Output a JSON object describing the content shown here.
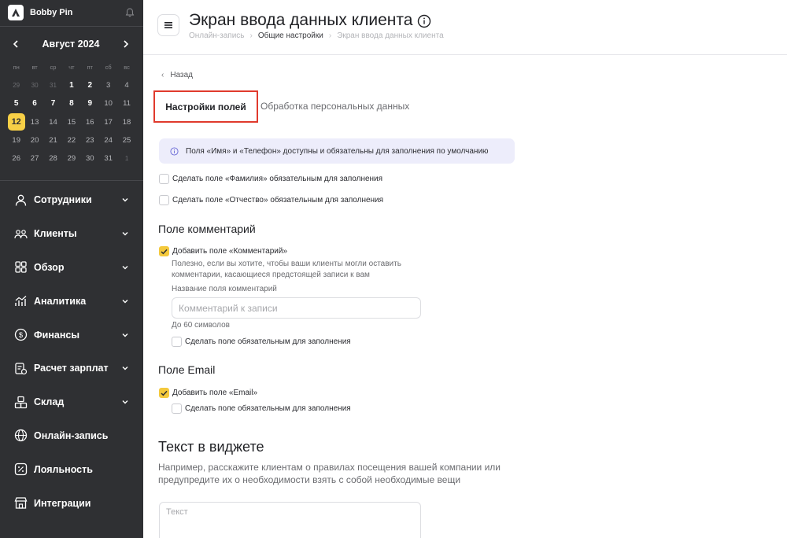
{
  "sidebar": {
    "brand": "Bobby Pin",
    "calendar": {
      "month": "Август 2024",
      "weekdays": [
        "пн",
        "вт",
        "ср",
        "чт",
        "пт",
        "сб",
        "вс"
      ],
      "weeks": [
        [
          {
            "d": "29",
            "t": "other"
          },
          {
            "d": "30",
            "t": "other"
          },
          {
            "d": "31",
            "t": "other"
          },
          {
            "d": "1",
            "t": "bold"
          },
          {
            "d": "2",
            "t": "bold"
          },
          {
            "d": "3",
            "t": "muted"
          },
          {
            "d": "4",
            "t": "muted"
          }
        ],
        [
          {
            "d": "5",
            "t": "bold"
          },
          {
            "d": "6",
            "t": "bold"
          },
          {
            "d": "7",
            "t": "bold"
          },
          {
            "d": "8",
            "t": "bold"
          },
          {
            "d": "9",
            "t": "bold"
          },
          {
            "d": "10",
            "t": "muted"
          },
          {
            "d": "11",
            "t": "muted"
          }
        ],
        [
          {
            "d": "12",
            "t": "today"
          },
          {
            "d": "13",
            "t": "muted"
          },
          {
            "d": "14",
            "t": "muted"
          },
          {
            "d": "15",
            "t": "muted"
          },
          {
            "d": "16",
            "t": "muted"
          },
          {
            "d": "17",
            "t": "muted"
          },
          {
            "d": "18",
            "t": "muted"
          }
        ],
        [
          {
            "d": "19",
            "t": "muted"
          },
          {
            "d": "20",
            "t": "muted"
          },
          {
            "d": "21",
            "t": "muted"
          },
          {
            "d": "22",
            "t": "muted"
          },
          {
            "d": "23",
            "t": "muted"
          },
          {
            "d": "24",
            "t": "muted"
          },
          {
            "d": "25",
            "t": "muted"
          }
        ],
        [
          {
            "d": "26",
            "t": "muted"
          },
          {
            "d": "27",
            "t": "muted"
          },
          {
            "d": "28",
            "t": "muted"
          },
          {
            "d": "29",
            "t": "muted"
          },
          {
            "d": "30",
            "t": "muted"
          },
          {
            "d": "31",
            "t": "muted"
          },
          {
            "d": "1",
            "t": "other"
          }
        ]
      ]
    },
    "nav": [
      {
        "label": "Сотрудники",
        "icon": "person-icon",
        "name": "employees",
        "chevron": true
      },
      {
        "label": "Клиенты",
        "icon": "users-icon",
        "name": "clients",
        "chevron": true
      },
      {
        "label": "Обзор",
        "icon": "grid-icon",
        "name": "overview",
        "chevron": true
      },
      {
        "label": "Аналитика",
        "icon": "analytics-icon",
        "name": "analytics",
        "chevron": true
      },
      {
        "label": "Финансы",
        "icon": "dollar-icon",
        "name": "finance",
        "chevron": true
      },
      {
        "label": "Расчет зарплат",
        "icon": "payroll-icon",
        "name": "payroll",
        "chevron": true
      },
      {
        "label": "Склад",
        "icon": "boxes-icon",
        "name": "warehouse",
        "chevron": true
      },
      {
        "label": "Онлайн-запись",
        "icon": "globe-icon",
        "name": "online-booking",
        "chevron": false
      },
      {
        "label": "Лояльность",
        "icon": "percent-icon",
        "name": "loyalty",
        "chevron": false
      },
      {
        "label": "Интеграции",
        "icon": "store-icon",
        "name": "integrations",
        "chevron": false
      }
    ]
  },
  "header": {
    "title": "Экран ввода данных клиента",
    "breadcrumb": [
      "Онлайн-запись",
      "Общие настройки",
      "Экран ввода данных клиента"
    ]
  },
  "main": {
    "back_label": "Назад",
    "tabs": [
      "Настройки полей",
      "Обработка персональных данных"
    ],
    "notice": "Поля «Имя» и «Телефон» доступны и обязательны для заполнения по умолчанию",
    "surname_required": "Сделать поле «Фамилия» обязательным для заполнения",
    "patronymic_required": "Сделать поле «Отчество» обязательным для заполнения",
    "comment_section": {
      "title": "Поле комментарий",
      "add_label": "Добавить поле «Комментарий»",
      "hint": "Полезно, если вы хотите, чтобы ваши клиенты могли оставить комментарии, касающиеся предстоящей записи к вам",
      "field_label": "Название поля комментарий",
      "placeholder": "Комментарий к записи",
      "limit": "До 60 символов",
      "required_label": "Сделать поле обязательным для заполнения"
    },
    "email_section": {
      "title": "Поле Email",
      "add_label": "Добавить поле «Email»",
      "required_label": "Сделать поле обязательным для заполнения"
    },
    "widget_section": {
      "title": "Текст в виджете",
      "description": "Например, расскажите клиентам о правилах посещения вашей компании или предупредите их о необходимости взять с собой необходимые вещи",
      "placeholder": "Текст"
    }
  },
  "colors": {
    "sidebar_bg": "#2f3033",
    "accent": "#f4c93d",
    "tab_highlight": "#e03a2d",
    "notice_bg": "#ededfb"
  }
}
